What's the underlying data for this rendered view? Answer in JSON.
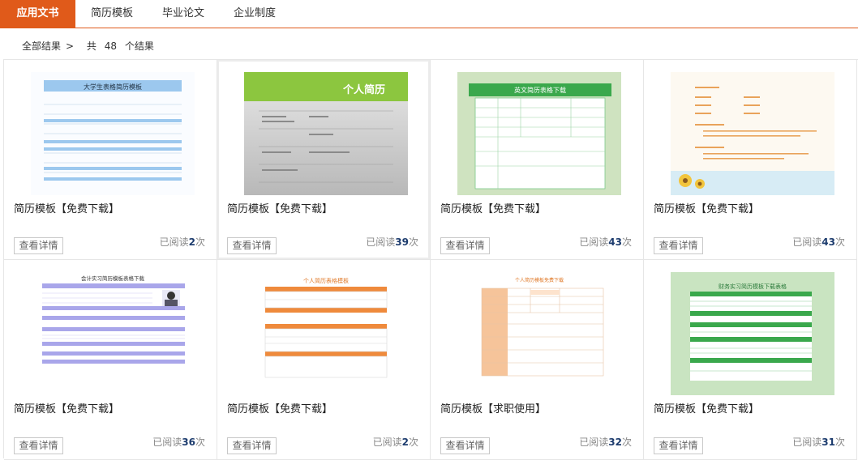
{
  "nav": {
    "tabs": [
      {
        "label": "应用文书",
        "active": true
      },
      {
        "label": "简历模板",
        "active": false
      },
      {
        "label": "毕业论文",
        "active": false
      },
      {
        "label": "企业制度",
        "active": false
      }
    ],
    "accent_color": "#e05a1a"
  },
  "breadcrumb": {
    "root": "全部结果",
    "separator": ">",
    "prefix": "共",
    "count": "48",
    "suffix": "个结果"
  },
  "cards": [
    {
      "title": "简历模板【免费下载】",
      "button": "查看详情",
      "reads_prefix": "已阅读",
      "reads": "2",
      "reads_suffix": "次",
      "thumb_title": "大学生表格简历模板"
    },
    {
      "title": "简历模板【免费下载】",
      "button": "查看详情",
      "reads_prefix": "已阅读",
      "reads": "39",
      "reads_suffix": "次",
      "thumb_title": "个人简历"
    },
    {
      "title": "简历模板【免费下载】",
      "button": "查看详情",
      "reads_prefix": "已阅读",
      "reads": "43",
      "reads_suffix": "次",
      "thumb_title": "英文简历表格下载"
    },
    {
      "title": "简历模板【免费下载】",
      "button": "查看详情",
      "reads_prefix": "已阅读",
      "reads": "43",
      "reads_suffix": "次",
      "thumb_title": ""
    },
    {
      "title": "简历模板【免费下载】",
      "button": "查看详情",
      "reads_prefix": "已阅读",
      "reads": "36",
      "reads_suffix": "次",
      "thumb_title": "会计实习简历模板表格下载"
    },
    {
      "title": "简历模板【免费下载】",
      "button": "查看详情",
      "reads_prefix": "已阅读",
      "reads": "2",
      "reads_suffix": "次",
      "thumb_title": "个人简历表格模板"
    },
    {
      "title": "简历模板【求职使用】",
      "button": "查看详情",
      "reads_prefix": "已阅读",
      "reads": "32",
      "reads_suffix": "次",
      "thumb_title": "个人简历模板免费下载"
    },
    {
      "title": "简历模板【免费下载】",
      "button": "查看详情",
      "reads_prefix": "已阅读",
      "reads": "31",
      "reads_suffix": "次",
      "thumb_title": "财务实习简历模板下载表格"
    }
  ]
}
